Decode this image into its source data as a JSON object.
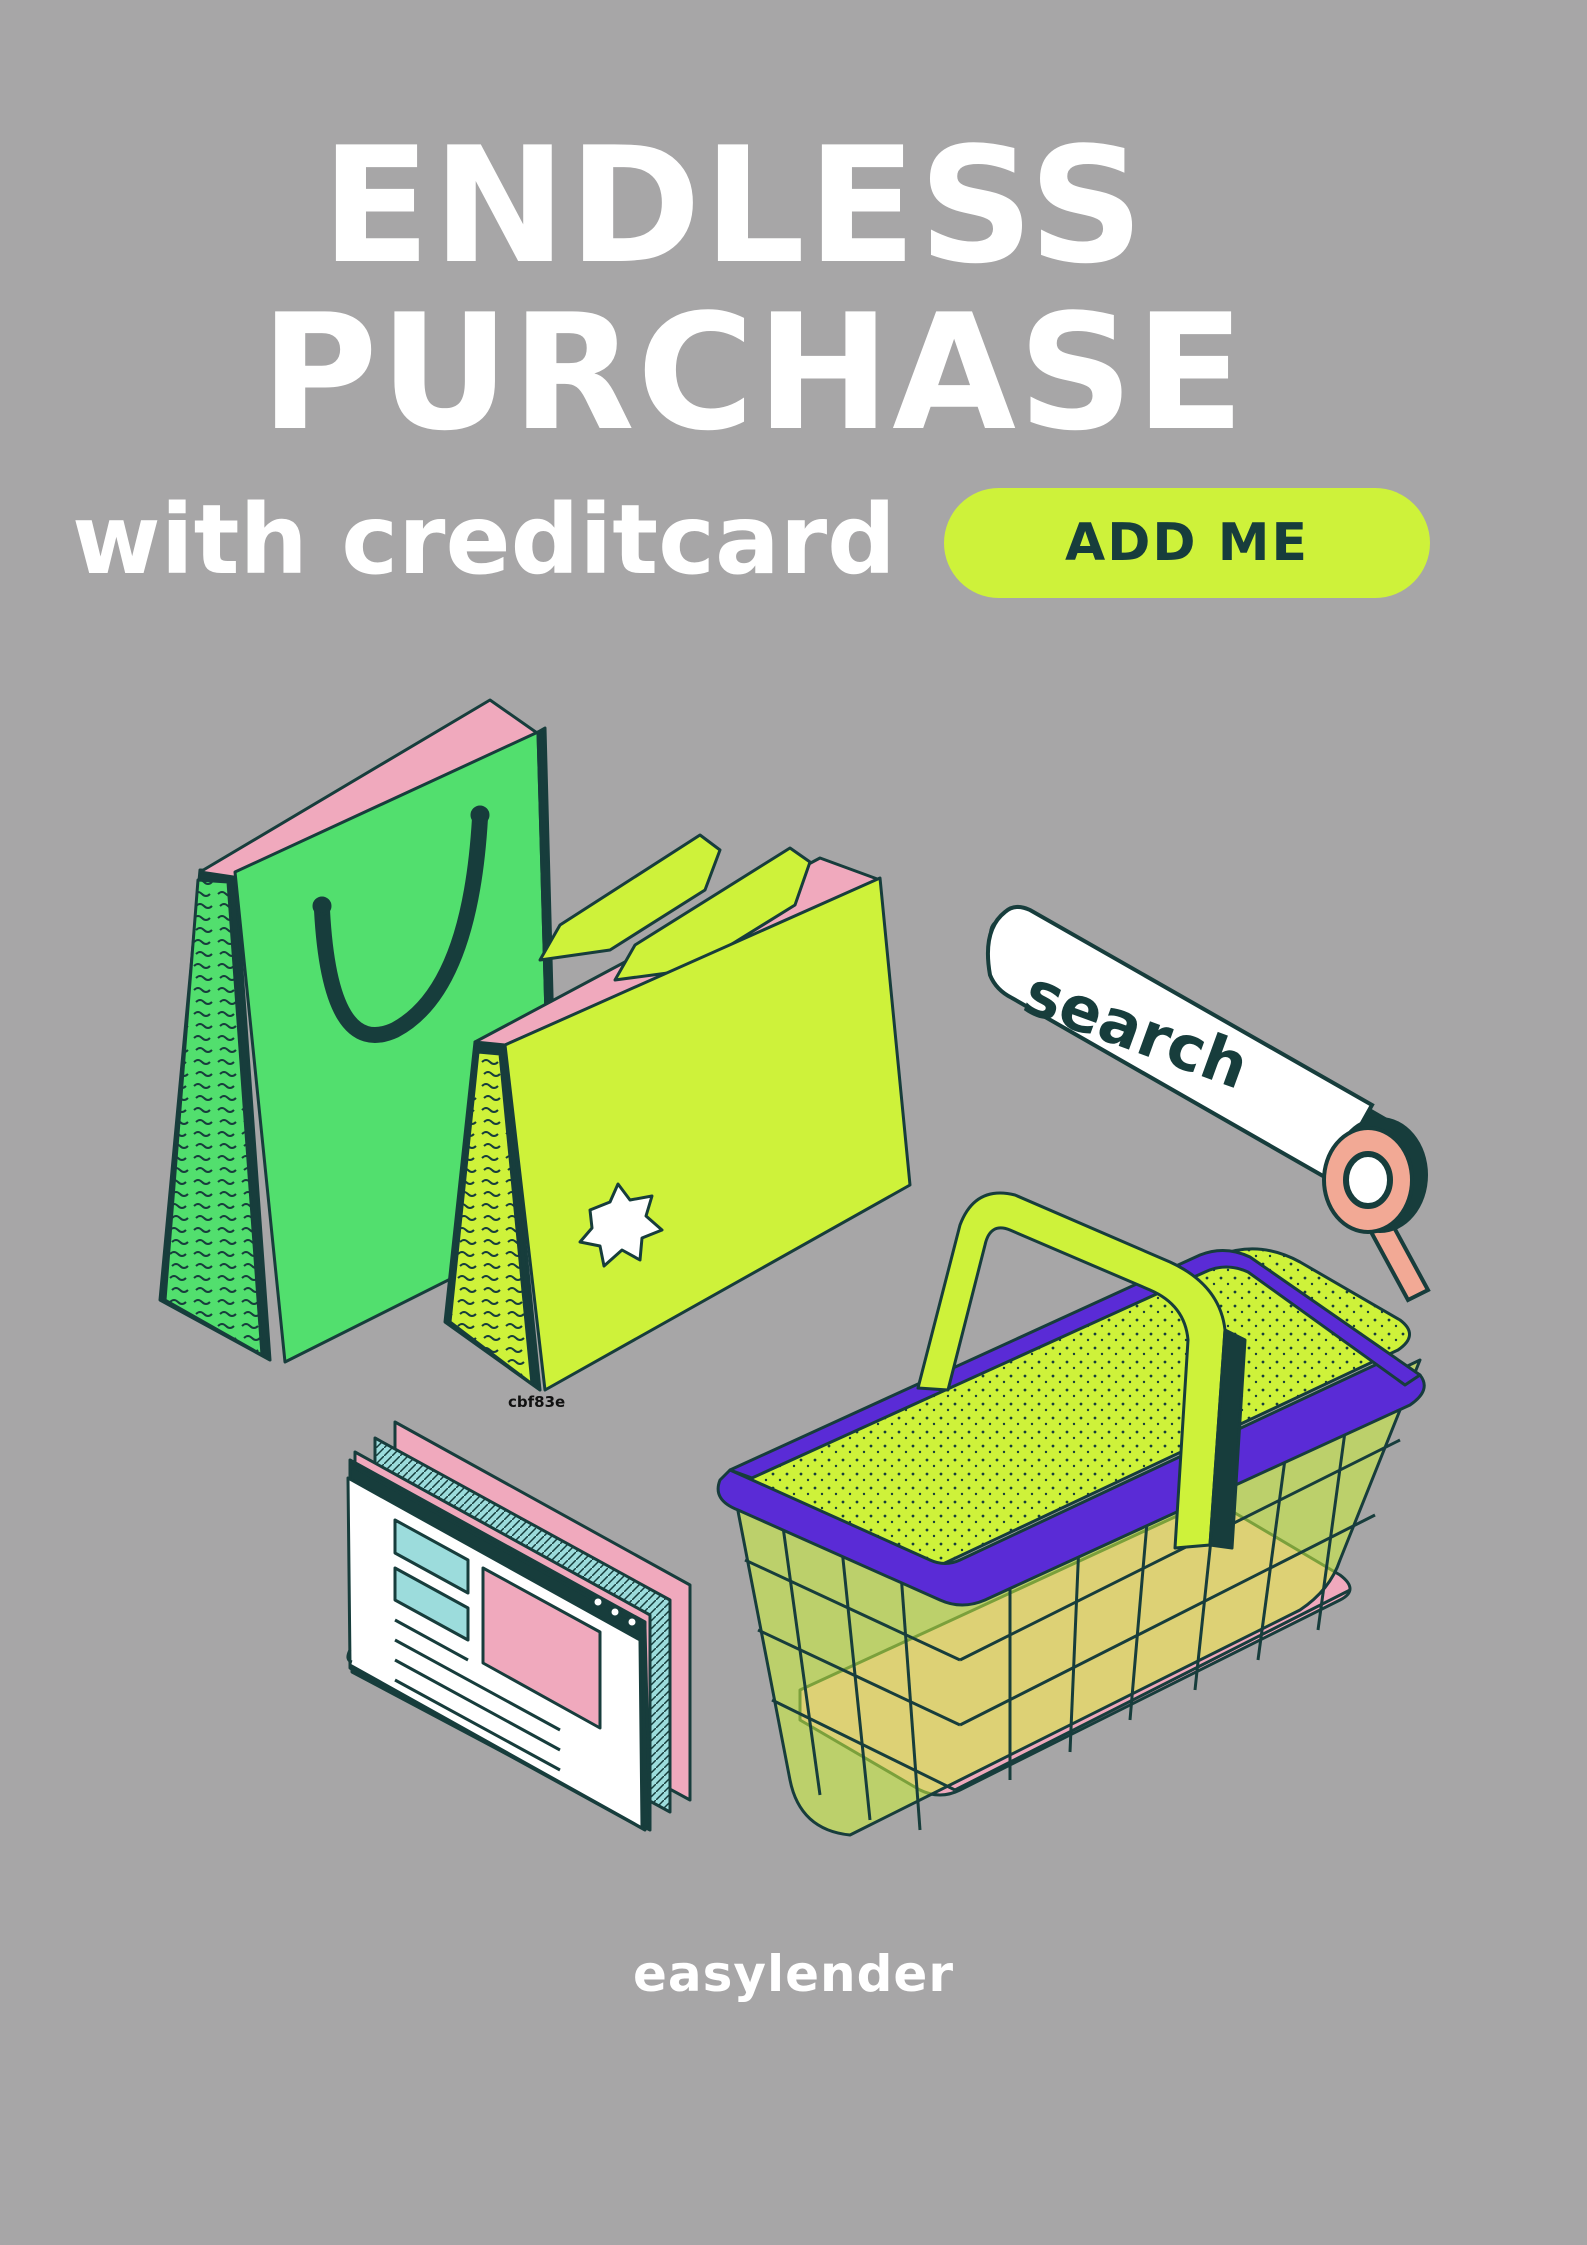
{
  "headline": {
    "line1": "ENDLESS",
    "line2": "PURCHASE",
    "subline": "with creditcard"
  },
  "cta": {
    "label": "ADD ME"
  },
  "illustration": {
    "search_bar_text": "search",
    "bag_tag": "cbf83e"
  },
  "footer": {
    "brand": "easylender"
  },
  "colors": {
    "background": "#a7a6a7",
    "accent_lime": "#cef23a",
    "green": "#52df6e",
    "pink": "#f0a9bd",
    "dark": "#173d3c",
    "purple": "#5a2bd6",
    "cyan": "#9cdcdc"
  }
}
